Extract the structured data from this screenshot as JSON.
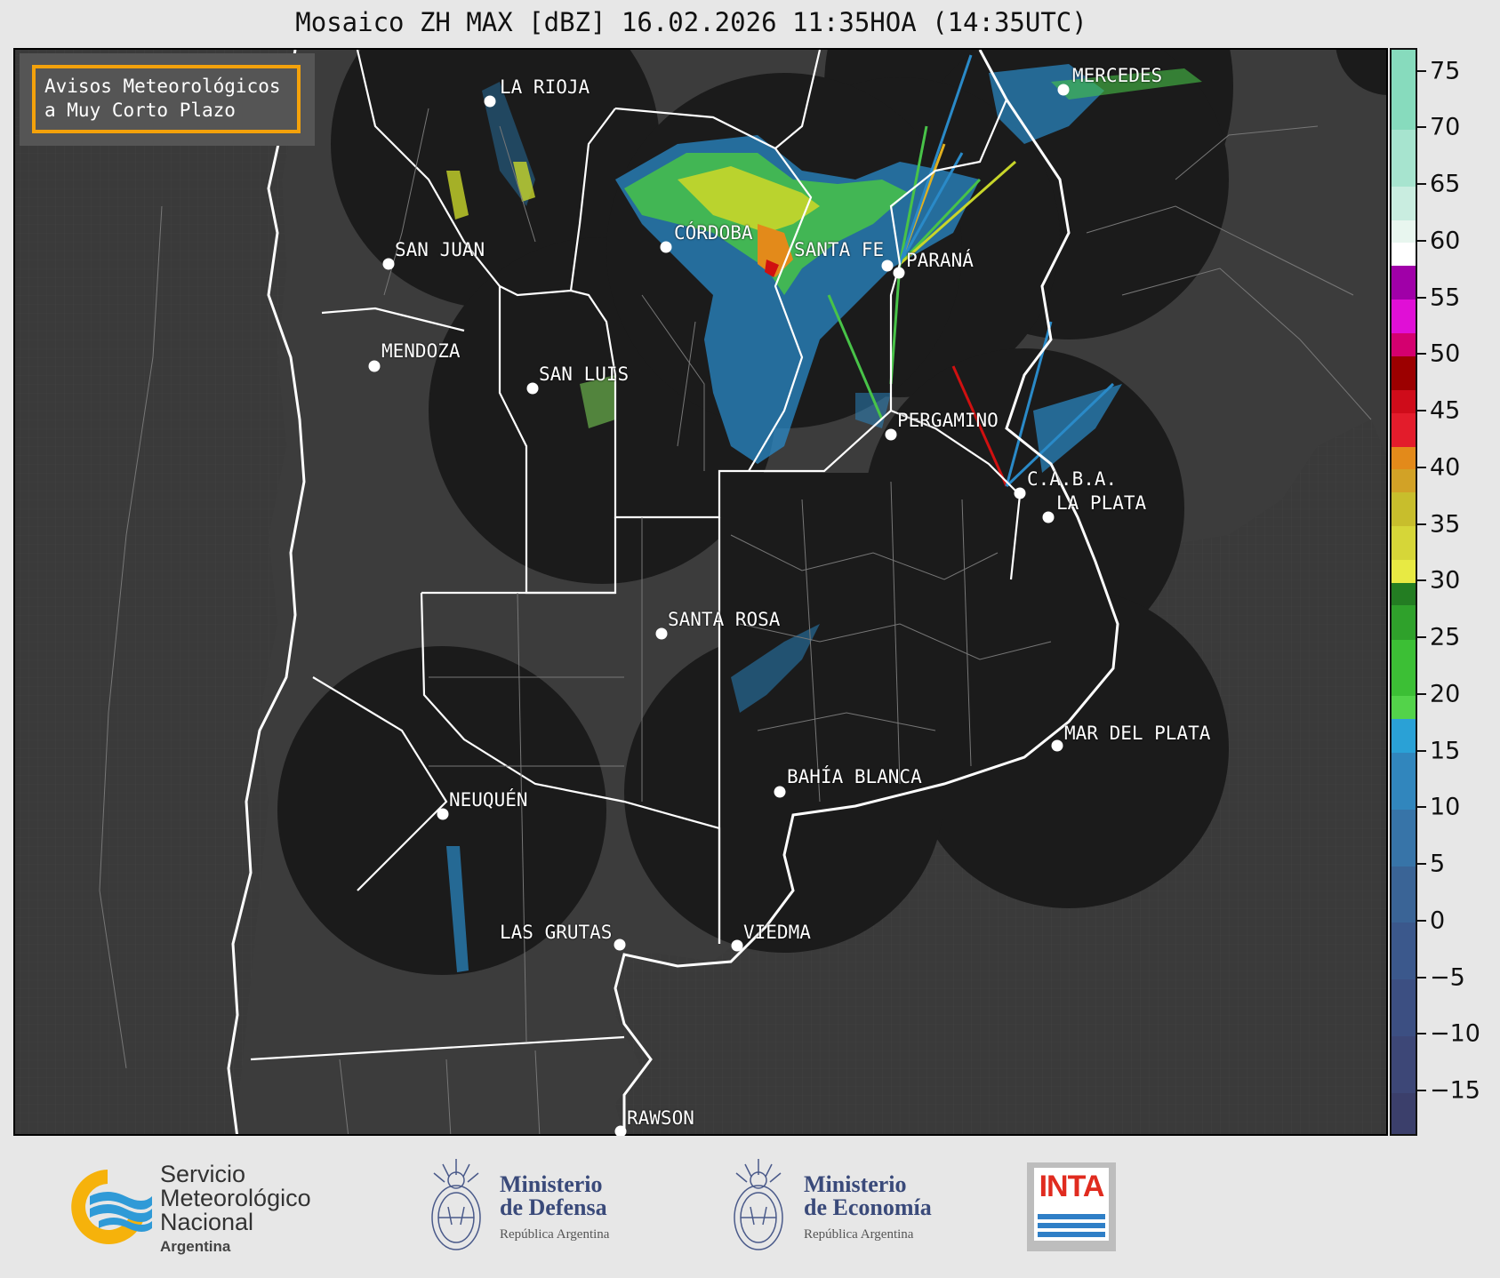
{
  "title": "Mosaico ZH MAX [dBZ] 16.02.2026 11:35HOA (14:35UTC)",
  "badge": {
    "line1": "Avisos Meteorológicos",
    "line2": "a Muy Corto Plazo",
    "border_color": "#f4a20b"
  },
  "colorbar": {
    "unit": "dBZ",
    "min": -19,
    "max": 77,
    "ticks": [
      "75",
      "70",
      "65",
      "60",
      "55",
      "50",
      "45",
      "40",
      "35",
      "30",
      "25",
      "20",
      "15",
      "10",
      "5",
      "0",
      "−5",
      "−10",
      "−15"
    ],
    "tick_values": [
      75,
      70,
      65,
      60,
      55,
      50,
      45,
      40,
      35,
      30,
      25,
      20,
      15,
      10,
      5,
      0,
      -5,
      -10,
      -15
    ]
  },
  "cities": [
    {
      "name": "LA RIOJA"
    },
    {
      "name": "MERCEDES"
    },
    {
      "name": "CÓRDOBA"
    },
    {
      "name": "SAN JUAN"
    },
    {
      "name": "SANTA FE"
    },
    {
      "name": "PARANÁ"
    },
    {
      "name": "MENDOZA"
    },
    {
      "name": "SAN LUIS"
    },
    {
      "name": "PERGAMINO"
    },
    {
      "name": "C.A.B.A."
    },
    {
      "name": "LA PLATA"
    },
    {
      "name": "SANTA ROSA"
    },
    {
      "name": "MAR DEL PLATA"
    },
    {
      "name": "BAHÍA BLANCA"
    },
    {
      "name": "NEUQUÉN"
    },
    {
      "name": "LAS GRUTAS"
    },
    {
      "name": "VIEDMA"
    },
    {
      "name": "RAWSON"
    }
  ],
  "logos": {
    "smn": {
      "line1": "Servicio",
      "line2": "Meteorológico",
      "line3": "Nacional",
      "sub": "Argentina",
      "icon": "smn-logo-icon"
    },
    "defensa": {
      "line1": "Ministerio",
      "line2": "de Defensa",
      "sub": "República Argentina",
      "icon": "national-shield-icon"
    },
    "economia": {
      "line1": "Ministerio",
      "line2": "de Economía",
      "sub": "República Argentina",
      "icon": "national-shield-icon"
    },
    "inta": {
      "text": "INTA",
      "icon": "inta-logo-icon"
    }
  },
  "colors": {
    "map_bg": "#3a3a3a",
    "radar_bg": "#1c1c1c",
    "border": "#ffffff",
    "accent": "#f4a20b"
  }
}
